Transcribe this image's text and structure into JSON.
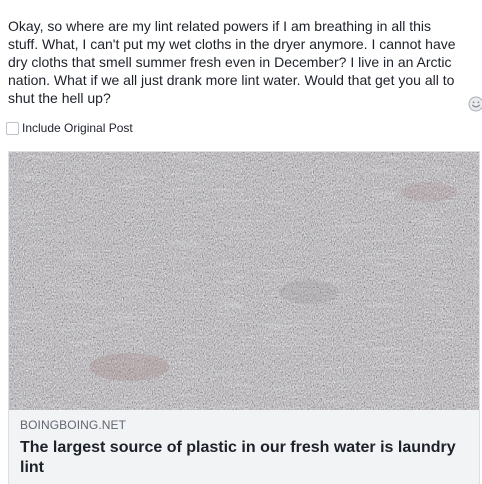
{
  "post": {
    "text": "Okay, so where are my lint related powers if I am breathing in all this stuff. What, I can't put my wet cloths in the dryer anymore. I cannot have dry cloths that smell summer fresh even in December? I live in an Arctic nation. What if we all just drank more lint water. Would that get you all to shut the hell up?"
  },
  "emoji_button": {
    "icon": "smiley-icon"
  },
  "include_original": {
    "label": "Include Original Post",
    "checked": false
  },
  "link_preview": {
    "image_icon": "lint-photo",
    "domain": "BOINGBOING.NET",
    "title": "The largest source of plastic in our fresh water is laundry lint"
  }
}
